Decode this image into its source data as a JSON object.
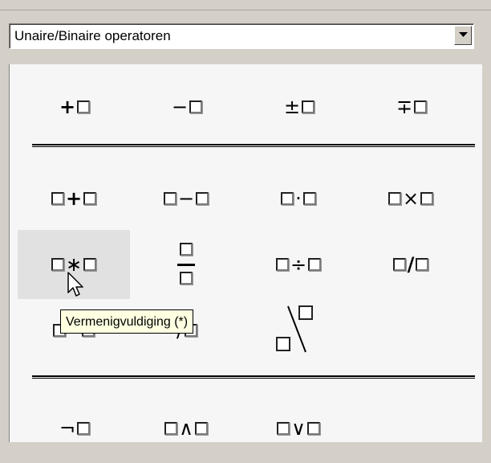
{
  "combo": {
    "value": "Unaire/Binaire operatoren",
    "button_icon": "chevron-down-icon"
  },
  "rows": [
    [
      {
        "name": "unary-plus",
        "left": "",
        "op": "+",
        "right": "box",
        "bold": true
      },
      {
        "name": "unary-minus",
        "left": "",
        "op": "−",
        "right": "box"
      },
      {
        "name": "plus-minus",
        "left": "",
        "op": "±",
        "right": "box"
      },
      {
        "name": "minus-plus",
        "left": "",
        "op": "∓",
        "right": "box"
      }
    ],
    [
      {
        "name": "add",
        "left": "box",
        "op": "+",
        "right": "box",
        "bold": true
      },
      {
        "name": "subtract",
        "left": "box",
        "op": "−",
        "right": "box"
      },
      {
        "name": "dot-multiply",
        "left": "box",
        "op": "·",
        "right": "box"
      },
      {
        "name": "cross-multiply",
        "left": "box",
        "op": "×",
        "right": "box"
      }
    ],
    [
      {
        "name": "star-multiply",
        "left": "box",
        "op": "∗",
        "right": "box",
        "hover": true
      },
      {
        "name": "fraction",
        "type": "fraction"
      },
      {
        "name": "divide",
        "left": "box",
        "op": "÷",
        "right": "box"
      },
      {
        "name": "slash-divide",
        "left": "box",
        "op": "/",
        "right": "box",
        "bold": true
      }
    ],
    [
      {
        "name": "concatenate",
        "left": "box",
        "op": "∘",
        "right": "box"
      },
      {
        "name": "wide-slash",
        "left": "",
        "op": "/",
        "right": "box"
      },
      {
        "name": "backslash",
        "type": "backslash"
      },
      {
        "name": "empty",
        "type": "empty"
      }
    ],
    [
      {
        "name": "logical-not",
        "left": "",
        "op": "¬",
        "right": "box"
      },
      {
        "name": "logical-and",
        "left": "box",
        "op": "∧",
        "right": "box"
      },
      {
        "name": "logical-or",
        "left": "box",
        "op": "∨",
        "right": "box"
      },
      {
        "name": "empty2",
        "type": "empty"
      }
    ]
  ],
  "tooltip": "Vermenigvuldiging (*)",
  "cursor_icon": "pointer-cursor-icon"
}
